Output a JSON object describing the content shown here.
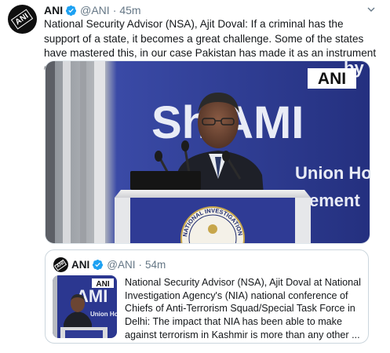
{
  "tweet": {
    "author_name": "ANI",
    "handle": "@ANI",
    "separator": "·",
    "time": "45m",
    "avatar_text": "ANI",
    "text": "National Security Advisor (NSA), Ajit Doval: If a criminal has the support of a state, it becomes a great challenge. Some of the states have mastered this, in our case Pakistan has made it as an instrument of its state policy.",
    "media": {
      "watermark": "ANI",
      "backdrop_line_1": "by",
      "backdrop_line_2": "Sh AMI",
      "backdrop_line_3": "Union Ho",
      "backdrop_line_4": "ement",
      "emblem_text": "NATIONAL INVESTIGATION AGENCY"
    }
  },
  "quoted": {
    "author_name": "ANI",
    "handle": "@ANI",
    "separator": "·",
    "time": "54m",
    "avatar_text": "ANI",
    "text": "National Security Advisor (NSA), Ajit Doval at National Investigation Agency's (NIA) national conference of Chiefs of Anti-Terrorism Squad/Special Task Force in Delhi: The impact that NIA has been able to make against terrorism in Kashmir is more than any other ...",
    "thumb_watermark": "ANI",
    "thumb_backdrop": "AMI",
    "thumb_backdrop_2": "Union Ho"
  },
  "colors": {
    "verified": "#1da1f2",
    "muted": "#657786",
    "stage_blue": "#2f3b95"
  },
  "icons": [
    "verified-badge-icon",
    "chevron-down-icon"
  ]
}
